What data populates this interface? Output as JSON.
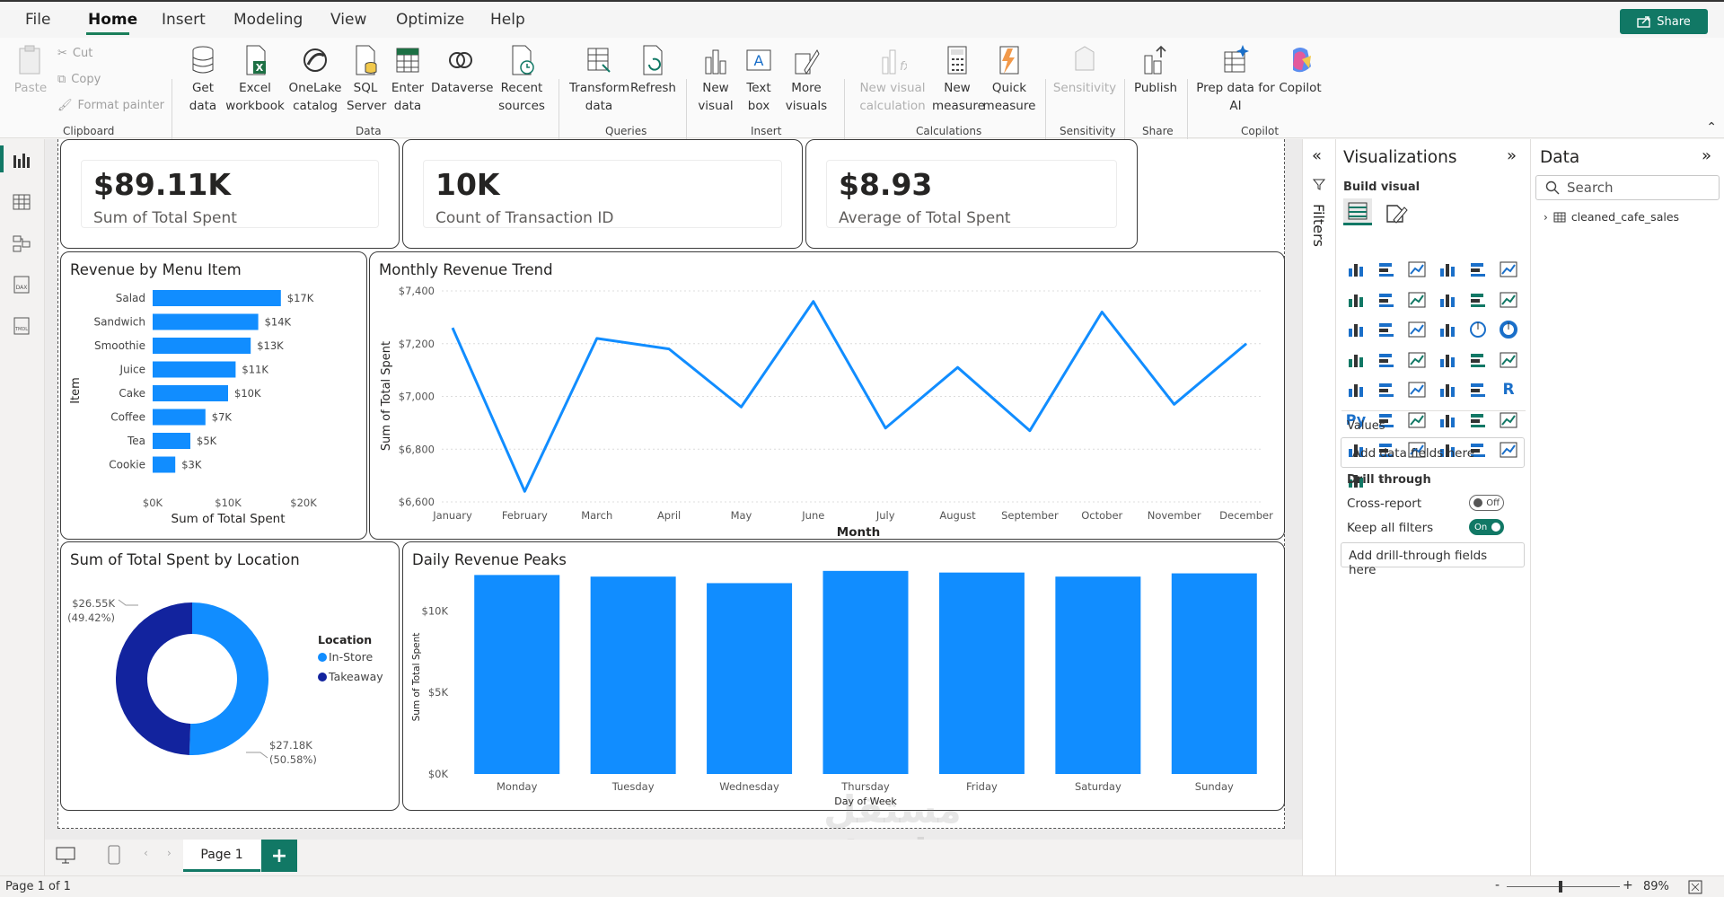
{
  "menu": {
    "file": "File",
    "home": "Home",
    "insert": "Insert",
    "modeling": "Modeling",
    "view": "View",
    "optimize": "Optimize",
    "help": "Help",
    "share": "Share"
  },
  "ribbon": {
    "paste": "Paste",
    "cut": "Cut",
    "copy": "Copy",
    "format_painter": "Format painter",
    "get_data_1": "Get",
    "get_data_2": "data",
    "excel_1": "Excel",
    "excel_2": "workbook",
    "onelake_1": "OneLake",
    "onelake_2": "catalog",
    "sql_1": "SQL",
    "sql_2": "Server",
    "enter_1": "Enter",
    "enter_2": "data",
    "dataverse": "Dataverse",
    "recent_1": "Recent",
    "recent_2": "sources",
    "transform_1": "Transform",
    "transform_2": "data",
    "refresh": "Refresh",
    "new_visual_1": "New",
    "new_visual_2": "visual",
    "text_box_1": "Text",
    "text_box_2": "box",
    "more_visuals_1": "More",
    "more_visuals_2": "visuals",
    "new_visual_calc_1": "New visual",
    "new_visual_calc_2": "calculation",
    "new_measure_1": "New",
    "new_measure_2": "measure",
    "quick_measure_1": "Quick",
    "quick_measure_2": "measure",
    "sensitivity": "Sensitivity",
    "publish": "Publish",
    "copilot_prep_1": "Prep data for",
    "copilot_prep_2": "AI",
    "copilot": "Copilot",
    "groups": {
      "clipboard": "Clipboard",
      "data": "Data",
      "queries": "Queries",
      "insert": "Insert",
      "calculations": "Calculations",
      "sensitivity": "Sensitivity",
      "share": "Share",
      "copilot": "Copilot"
    }
  },
  "kpis": [
    {
      "value": "$89.11K",
      "label": "Sum of Total Spent"
    },
    {
      "value": "10K",
      "label": "Count of Transaction ID"
    },
    {
      "value": "$8.93",
      "label": "Average of Total Spent"
    }
  ],
  "charts": {
    "menu": {
      "title": "Revenue by Menu Item",
      "ylabel": "Item",
      "xlabel": "Sum of Total Spent",
      "xticks": [
        "$0K",
        "$10K",
        "$20K"
      ]
    },
    "monthly": {
      "title": "Monthly Revenue Trend",
      "ylabel": "Sum of Total Spent",
      "xlabel": "Month",
      "yticks": [
        "$7,400",
        "$7,200",
        "$7,000",
        "$6,800",
        "$6,600"
      ]
    },
    "location": {
      "title": "Sum of Total Spent by Location",
      "legend_title": "Location",
      "label_takeaway_1": "$26.55K",
      "label_takeaway_2": "(49.42%)",
      "label_instore_1": "$27.18K",
      "label_instore_2": "(50.58%)"
    },
    "daily": {
      "title": "Daily Revenue Peaks",
      "ylabel": "Sum of Total Spent",
      "xlabel": "Day of Week",
      "yticks": [
        "$10K",
        "$5K",
        "$0K"
      ]
    }
  },
  "chart_data": [
    {
      "type": "bar",
      "title": "Revenue by Menu Item",
      "orientation": "horizontal",
      "xlabel": "Sum of Total Spent",
      "ylabel": "Item",
      "xlim": [
        0,
        20000
      ],
      "categories": [
        "Salad",
        "Sandwich",
        "Smoothie",
        "Juice",
        "Cake",
        "Coffee",
        "Tea",
        "Cookie"
      ],
      "values": [
        17000,
        14000,
        13000,
        11000,
        10000,
        7000,
        5000,
        3000
      ],
      "data_labels": [
        "$17K",
        "$14K",
        "$13K",
        "$11K",
        "$10K",
        "$7K",
        "$5K",
        "$3K"
      ],
      "color": "#118dff"
    },
    {
      "type": "line",
      "title": "Monthly Revenue Trend",
      "xlabel": "Month",
      "ylabel": "Sum of Total Spent",
      "ylim": [
        6600,
        7400
      ],
      "categories": [
        "January",
        "February",
        "March",
        "April",
        "May",
        "June",
        "July",
        "August",
        "September",
        "October",
        "November",
        "December"
      ],
      "values": [
        7260,
        6640,
        7220,
        7180,
        6960,
        7360,
        6880,
        7110,
        6870,
        7320,
        6970,
        7200
      ],
      "color": "#118dff",
      "grid": true
    },
    {
      "type": "pie",
      "title": "Sum of Total Spent by Location",
      "donut": true,
      "categories": [
        "In-Store",
        "Takeaway"
      ],
      "values": [
        27180,
        26550
      ],
      "colors": [
        "#118dff",
        "#12239e"
      ],
      "legend_position": "right"
    },
    {
      "type": "bar",
      "title": "Daily Revenue Peaks",
      "xlabel": "Day of Week",
      "ylabel": "Sum of Total Spent",
      "ylim": [
        0,
        12000
      ],
      "categories": [
        "Monday",
        "Tuesday",
        "Wednesday",
        "Thursday",
        "Friday",
        "Saturday",
        "Sunday"
      ],
      "values": [
        12200,
        12100,
        11700,
        12450,
        12350,
        12100,
        12300
      ],
      "color": "#118dff"
    }
  ],
  "viz_pane": {
    "title": "Visualizations",
    "build_visual": "Build visual",
    "values": "Values",
    "add_data_fields": "Add data fields here",
    "drill_through": "Drill through",
    "cross_report": "Cross-report",
    "cross_report_state": "Off",
    "keep_all_filters": "Keep all filters",
    "keep_all_filters_state": "On",
    "add_drill_fields": "Add drill-through fields here"
  },
  "filters_pane": {
    "label": "Filters"
  },
  "data_pane": {
    "title": "Data",
    "search_placeholder": "Search",
    "table": "cleaned_cafe_sales"
  },
  "pages": {
    "current": "Page 1",
    "status": "Page 1 of 1",
    "zoom": "89%"
  },
  "watermark": {
    "line1": "مستقل",
    "line2": "mostaql.com"
  },
  "colors": {
    "accent": "#117865",
    "bar": "#118dff",
    "dark_series": "#12239e"
  }
}
